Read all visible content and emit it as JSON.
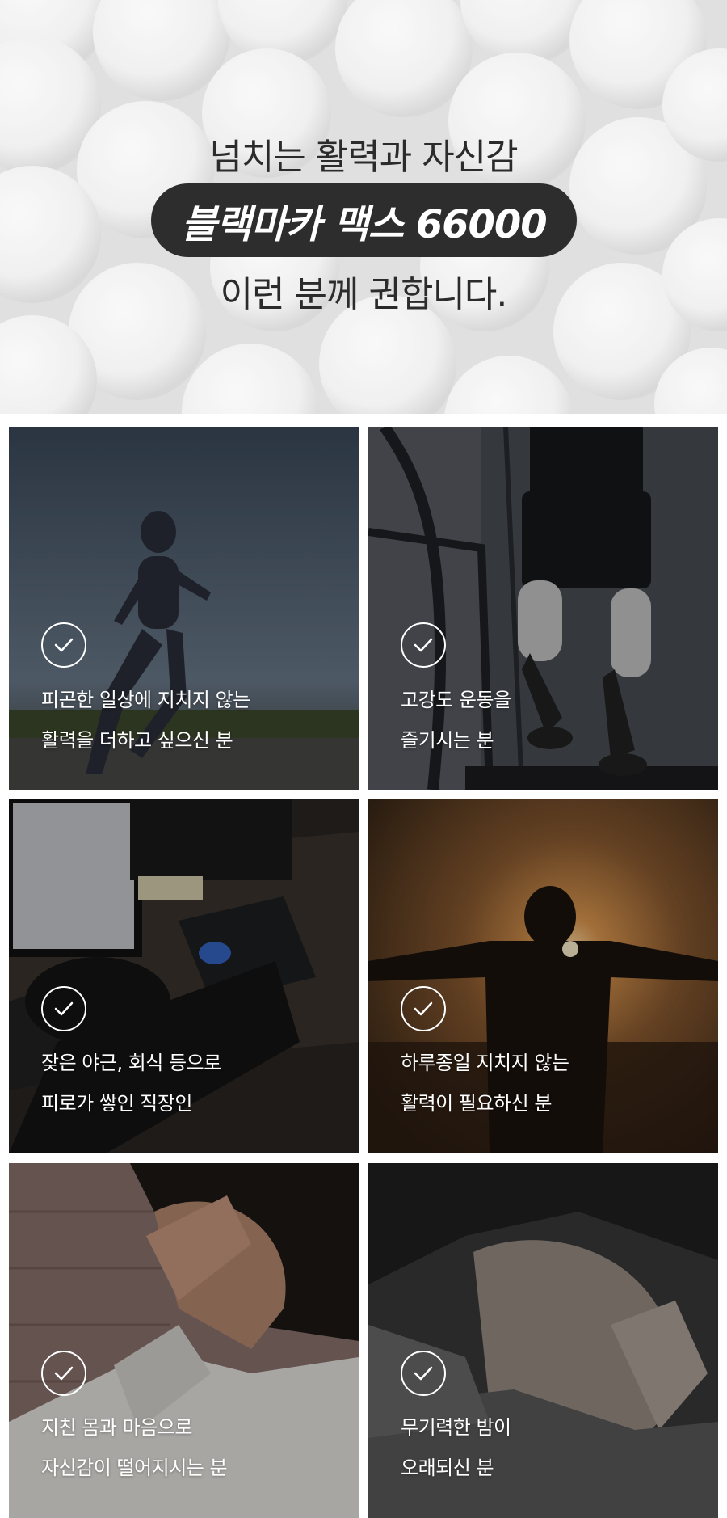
{
  "hero": {
    "line1": "넘치는 활력과 자신감",
    "product": "블랙마카 맥스 66000",
    "line3": "이런 분께 권합니다."
  },
  "cards": [
    {
      "line1": "피곤한 일상에 지치지 않는",
      "line2": "활력을 더하고 싶으신 분",
      "icon": "check-circle-icon",
      "photo": "running-woman"
    },
    {
      "line1": "고강도 운동을",
      "line2": "즐기시는 분",
      "icon": "check-circle-icon",
      "photo": "treadmill-runner"
    },
    {
      "line1": "잦은 야근, 회식 등으로",
      "line2": "피로가 쌓인 직장인",
      "icon": "check-circle-icon",
      "photo": "tired-office-worker"
    },
    {
      "line1": "하루종일 지치지 않는",
      "line2": "활력이 필요하신 분",
      "icon": "check-circle-icon",
      "photo": "man-sunset-arms-open"
    },
    {
      "line1": "지친 몸과 마음으로",
      "line2": "자신감이 떨어지시는 분",
      "icon": "check-circle-icon",
      "photo": "stressed-man"
    },
    {
      "line1": "무기력한 밤이",
      "line2": "오래되신 분",
      "icon": "check-circle-icon",
      "photo": "sleeping-child"
    }
  ],
  "colors": {
    "pill": "#2d2d2d",
    "heading": "#2b2b2b",
    "card_text": "#ffffff"
  }
}
